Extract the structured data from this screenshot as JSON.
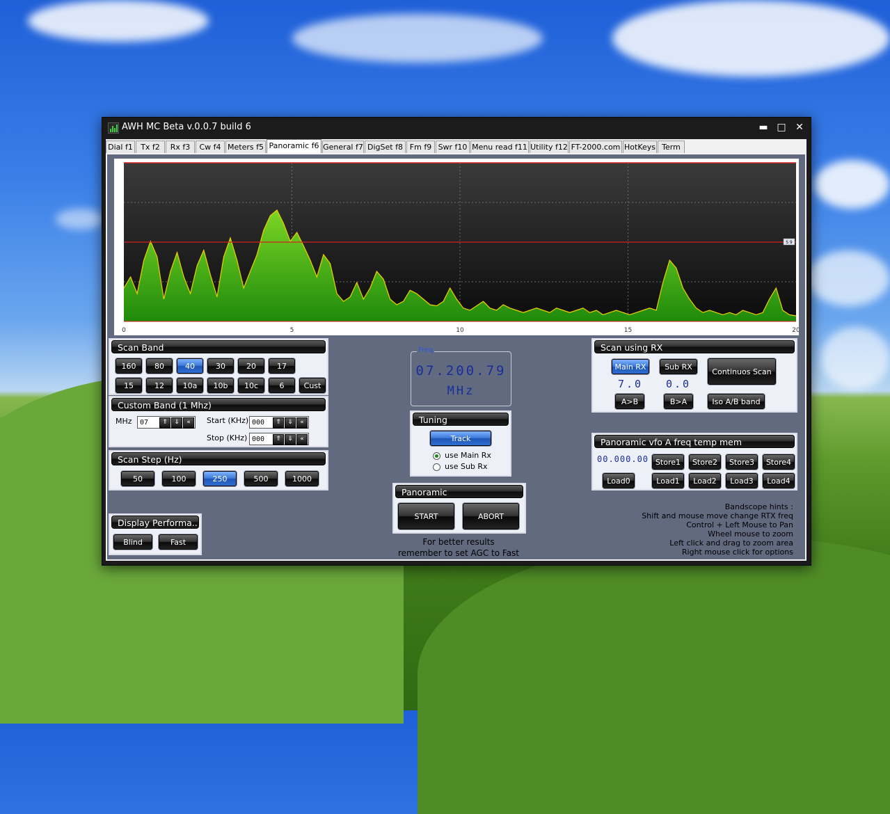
{
  "window": {
    "title": "AWH MC Beta v.0.0.7 build 6",
    "minimize": "▬",
    "maximize": "□",
    "close": "✕"
  },
  "tabs": [
    {
      "label": "Dial  f1"
    },
    {
      "label": "Tx  f2"
    },
    {
      "label": "Rx  f3"
    },
    {
      "label": "Cw  f4"
    },
    {
      "label": "Meters  f5"
    },
    {
      "label": "Panoramic  f6",
      "active": true
    },
    {
      "label": "General  f7"
    },
    {
      "label": "DigSet  f8"
    },
    {
      "label": "Fm  f9"
    },
    {
      "label": "Swr  f10"
    },
    {
      "label": "Menu read  f11"
    },
    {
      "label": "Utility  f12"
    },
    {
      "label": "FT-2000.com"
    },
    {
      "label": "HotKeys"
    },
    {
      "label": "Term"
    }
  ],
  "scope": {
    "axis_ticks": [
      "0",
      "5",
      "10",
      "15",
      "20"
    ],
    "s9_marker": "S 9",
    "colors": {
      "fill": "#3fa516",
      "line": "#f0d000",
      "redline": "#d42020",
      "bg": "#1a1a1a"
    },
    "spectrum_profile": [
      0.3,
      0.4,
      0.25,
      0.55,
      0.72,
      0.58,
      0.2,
      0.45,
      0.62,
      0.4,
      0.25,
      0.5,
      0.64,
      0.42,
      0.22,
      0.58,
      0.75,
      0.55,
      0.3,
      0.45,
      0.6,
      0.82,
      0.95,
      1.0,
      0.88,
      0.72,
      0.8,
      0.68,
      0.55,
      0.4,
      0.6,
      0.52,
      0.25,
      0.18,
      0.22,
      0.35,
      0.2,
      0.3,
      0.45,
      0.38,
      0.2,
      0.15,
      0.18,
      0.28,
      0.25,
      0.2,
      0.15,
      0.14,
      0.18,
      0.3,
      0.2,
      0.12,
      0.1,
      0.14,
      0.18,
      0.12,
      0.1,
      0.15,
      0.12,
      0.1,
      0.08,
      0.1,
      0.12,
      0.1,
      0.08,
      0.12,
      0.1,
      0.08,
      0.1,
      0.12,
      0.08,
      0.1,
      0.06,
      0.08,
      0.1,
      0.08,
      0.06,
      0.08,
      0.1,
      0.12,
      0.1,
      0.35,
      0.55,
      0.48,
      0.3,
      0.2,
      0.12,
      0.08,
      0.1,
      0.08,
      0.06,
      0.08,
      0.06,
      0.1,
      0.08,
      0.06,
      0.08,
      0.2,
      0.3,
      0.1,
      0.06,
      0.05
    ]
  },
  "scan_band": {
    "title": "Scan Band",
    "row1": [
      {
        "label": "160"
      },
      {
        "label": "80"
      },
      {
        "label": "40",
        "selected": true
      },
      {
        "label": "30"
      },
      {
        "label": "20"
      },
      {
        "label": "17"
      }
    ],
    "row2": [
      {
        "label": "15"
      },
      {
        "label": "12"
      },
      {
        "label": "10a"
      },
      {
        "label": "10b"
      },
      {
        "label": "10c"
      },
      {
        "label": "6"
      },
      {
        "label": "Cust"
      }
    ]
  },
  "custom_band": {
    "title": "Custom Band (1 Mhz)",
    "mhz_label": "MHz",
    "mhz_value": "07",
    "start_label": "Start (KHz)",
    "start_value": "000",
    "stop_label": "Stop (KHz)",
    "stop_value": "000",
    "spin_up": "⇑",
    "spin_down": "⇓",
    "spin_reset": "«"
  },
  "scan_step": {
    "title": "Scan Step (Hz)",
    "steps": [
      {
        "label": "50"
      },
      {
        "label": "100"
      },
      {
        "label": "250",
        "selected": true
      },
      {
        "label": "500"
      },
      {
        "label": "1000"
      }
    ]
  },
  "display_perf": {
    "title": "Display Performa...",
    "blind": "Blind",
    "fast": "Fast"
  },
  "freq": {
    "legend": "Freq",
    "value": "07.200.79",
    "unit": "MHz"
  },
  "tuning": {
    "title": "Tuning",
    "track": "Track",
    "main_rx": "use Main Rx",
    "sub_rx": "use Sub  Rx"
  },
  "panoramic": {
    "title": "Panoramic",
    "start": "START",
    "abort": "ABORT",
    "note_line1": "For better results",
    "note_line2": "remember to set AGC to Fast"
  },
  "scan_rx": {
    "title": "Scan using RX",
    "main_rx": "Main RX",
    "sub_rx": "Sub  RX",
    "continuous": "Continuos Scan",
    "main_val": "7.0",
    "sub_val": "0.0",
    "a_to_b": "A>B",
    "b_to_a": "B>A",
    "iso": "Iso A/B band"
  },
  "vfo_mem": {
    "title": "Panoramic vfo A freq temp mem",
    "display": "00.000.00",
    "store": [
      "Store1",
      "Store2",
      "Store3",
      "Store4"
    ],
    "load": [
      "Load0",
      "Load1",
      "Load2",
      "Load3",
      "Load4"
    ]
  },
  "hints": {
    "title": "Bandscope hints :",
    "lines": [
      "Shift and mouse move change RTX freq",
      "Control + Left Mouse to Pan",
      "Wheel mouse to zoom",
      "Left click and drag to zoom area",
      "Right mouse click for options"
    ]
  }
}
